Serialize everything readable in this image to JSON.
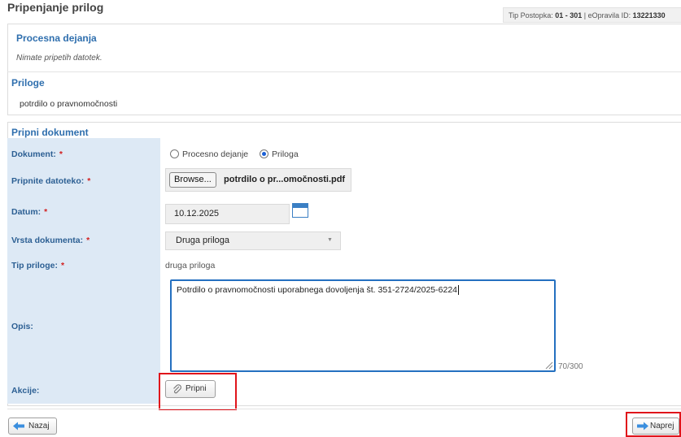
{
  "page": {
    "title": "Pripenjanje prilog"
  },
  "tip_bar": {
    "prefix": "Tip Postopka:",
    "type_value": "01 - 301",
    "separator": "| eOpravila ID:",
    "id_value": "13221330"
  },
  "procesna": {
    "title": "Procesna dejanja",
    "message": "Nimate pripetih datotek."
  },
  "priloge": {
    "title": "Priloge",
    "item": "potrdilo o pravnomočnosti"
  },
  "form": {
    "title": "Pripni dokument",
    "required_marker": "*",
    "dokument": {
      "label": "Dokument:",
      "options": [
        "Procesno dejanje",
        "Priloga"
      ],
      "selected": "Priloga"
    },
    "datoteka": {
      "label": "Pripnite datoteko:",
      "browse": "Browse...",
      "filename": "potrdilo o pr...omočnosti.pdf"
    },
    "datum": {
      "label": "Datum:",
      "value": "10.12.2025"
    },
    "vrsta": {
      "label": "Vrsta dokumenta:",
      "value": "Druga priloga",
      "arrow": "▼"
    },
    "tip": {
      "label": "Tip priloge:",
      "value": "druga priloga"
    },
    "opis": {
      "label": "Opis:",
      "value": "Potrdilo o pravnomočnosti uporabnega dovoljenja št. 351-2724/2025-6224",
      "counter": "70/300"
    },
    "akcije": {
      "label": "Akcije:",
      "button": "Pripni"
    }
  },
  "footer": {
    "back": "Nazaj",
    "next": "Naprej"
  },
  "colors": {
    "accent": "#2f6fae",
    "highlight": "#e0141b",
    "label_bg": "#dde9f5"
  }
}
